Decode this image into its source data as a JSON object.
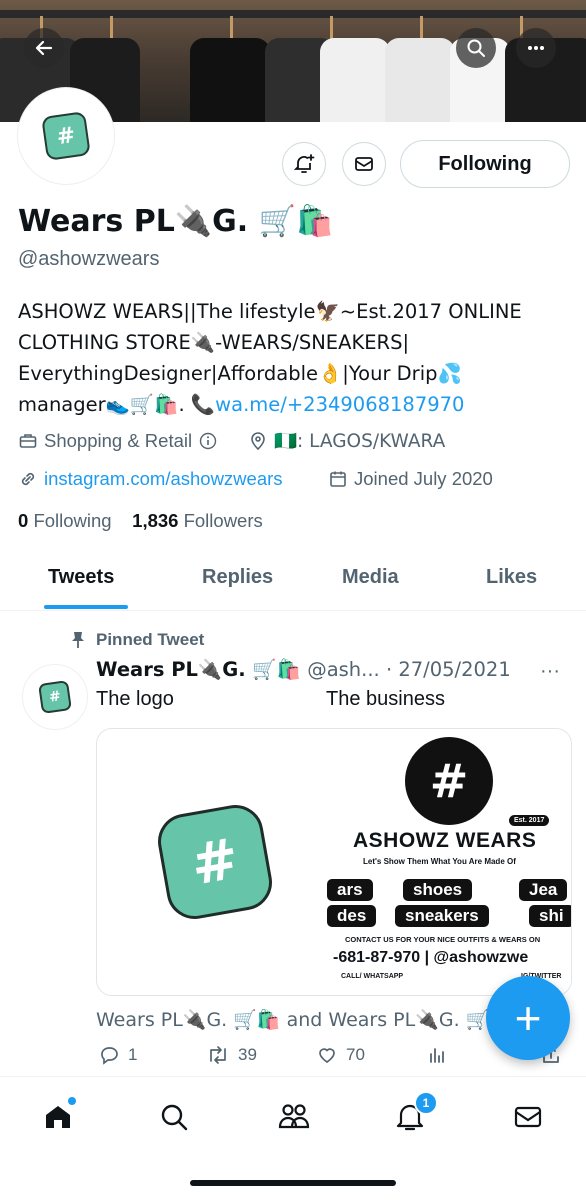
{
  "profile": {
    "display_name": "Wears PL🔌G. 🛒🛍️",
    "handle": "@ashowzwears",
    "bio_line1": "ASHOWZ WEARS||The lifestyle🦅~Est.2017 ONLINE",
    "bio_line2": "CLOTHING STORE🔌-WEARS/SNEAKERS|",
    "bio_line3": "EverythingDesigner|Affordable👌|Your Drip💦",
    "bio_line4": "manager👟🛒🛍️. 📞",
    "bio_link": "wa.me/+2349068187970",
    "category": "Shopping & Retail",
    "location": "🇳🇬: LAGOS/KWARA",
    "website": "instagram.com/ashowzwears",
    "joined": "Joined July 2020",
    "following_count": "0",
    "following_label": "Following",
    "followers_count": "1,836",
    "followers_label": "Followers"
  },
  "buttons": {
    "following": "Following"
  },
  "tabs": [
    "Tweets",
    "Replies",
    "Media",
    "Likes"
  ],
  "tweet": {
    "pinned_label": "Pinned Tweet",
    "author": "Wears PL🔌G. 🛒🛍️",
    "meta": "@ash... · 27/05/2021",
    "text_left": "The logo",
    "text_right": "The business",
    "liked_by": "Wears PL🔌G. 🛒🛍️ and Wears PL🔌G. 🛒",
    "replies": "1",
    "retweets": "39",
    "likes": "70",
    "media": {
      "logo_symbol": "#",
      "est": "Est. 2017",
      "brand": "ASHOWZ WEARS",
      "tagline": "Let's Show Them What You Are Made Of",
      "pill1": "ars",
      "pill2": "shoes",
      "pill3": "Jea",
      "pill4": "des",
      "pill5": "sneakers",
      "pill6": "shi",
      "contact": "CONTACT US FOR YOUR NICE OUTFITS & WEARS ON",
      "phone": "-681-87-970  |  @ashowzwe",
      "call": "CALL/ WHATSAPP",
      "ig": "IG/TWITTER"
    }
  },
  "nav": {
    "notifications_badge": "1"
  },
  "colors": {
    "accent": "#1d9bf0",
    "logo_green": "#66c4a8",
    "text_secondary": "#536471"
  }
}
